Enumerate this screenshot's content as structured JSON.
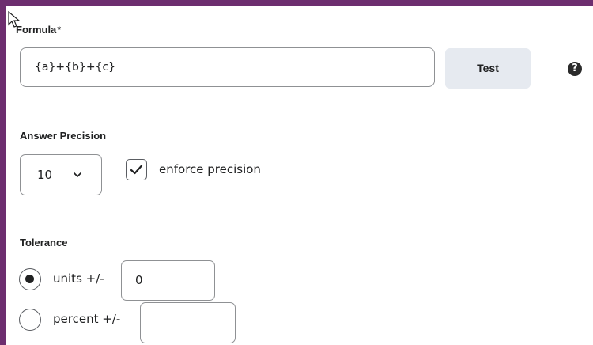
{
  "colors": {
    "frame": "#6d2e6f",
    "test_button_bg": "#e6eaf0",
    "border": "#8f9194"
  },
  "formula": {
    "label": "Formula",
    "required_marker": "*",
    "value": "{a}+{b}+{c}",
    "test_label": "Test",
    "help_icon": "question-circle-icon",
    "help_glyph": "?"
  },
  "precision": {
    "label": "Answer Precision",
    "selected": "10",
    "enforce_label": "enforce precision",
    "enforce_checked": true
  },
  "tolerance": {
    "label": "Tolerance",
    "units_label": "units",
    "units_suffix": "+/-",
    "units_value": "0",
    "units_selected": true,
    "percent_label": "percent",
    "percent_suffix": "+/-",
    "percent_value": "",
    "percent_selected": false
  }
}
